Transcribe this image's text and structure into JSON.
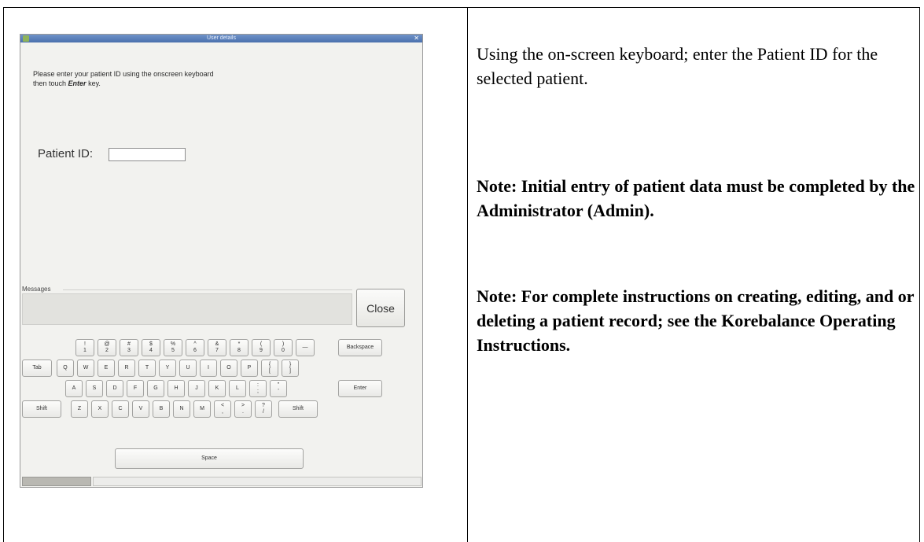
{
  "window": {
    "title": "User details",
    "instruction_line1": "Please enter your patient ID using the onscreen keyboard",
    "instruction_line2_pre": "then touch ",
    "instruction_line2_key": "Enter",
    "instruction_line2_post": " key.",
    "patient_id_label": "Patient ID:",
    "patient_id_value": "",
    "messages_label": "Messages",
    "close_label": "Close"
  },
  "keyboard": {
    "number_keys": [
      "!\n1",
      "@\n2",
      "#\n3",
      "$\n4",
      "%\n5",
      "^\n6",
      "&\n7",
      "*\n8",
      "(\n9",
      ")\n0",
      "—"
    ],
    "backspace": "Backspace",
    "tab": "Tab",
    "row_qwerty": [
      "Q",
      "W",
      "E",
      "R",
      "T",
      "Y",
      "U",
      "I",
      "O",
      "P",
      "{\n[",
      "}\n]"
    ],
    "row_asdf": [
      "A",
      "S",
      "D",
      "F",
      "G",
      "H",
      "J",
      "K",
      "L",
      ":\n;",
      "\"\n'"
    ],
    "enter": "Enter",
    "shift_left": "Shift",
    "row_zxcv": [
      "Z",
      "X",
      "C",
      "V",
      "B",
      "N",
      "M",
      "<\n,",
      ">\n.",
      "?\n/"
    ],
    "shift_right": "Shift",
    "space": "Space"
  },
  "right_column": {
    "paragraph": "Using the on-screen keyboard; enter the Patient ID for the selected patient.",
    "note1": "Note:  Initial entry of patient data must be completed by the Administrator (Admin).",
    "note2": "Note:  For complete instructions on creating, editing, and or deleting a patient record; see the Korebalance Operating Instructions."
  }
}
